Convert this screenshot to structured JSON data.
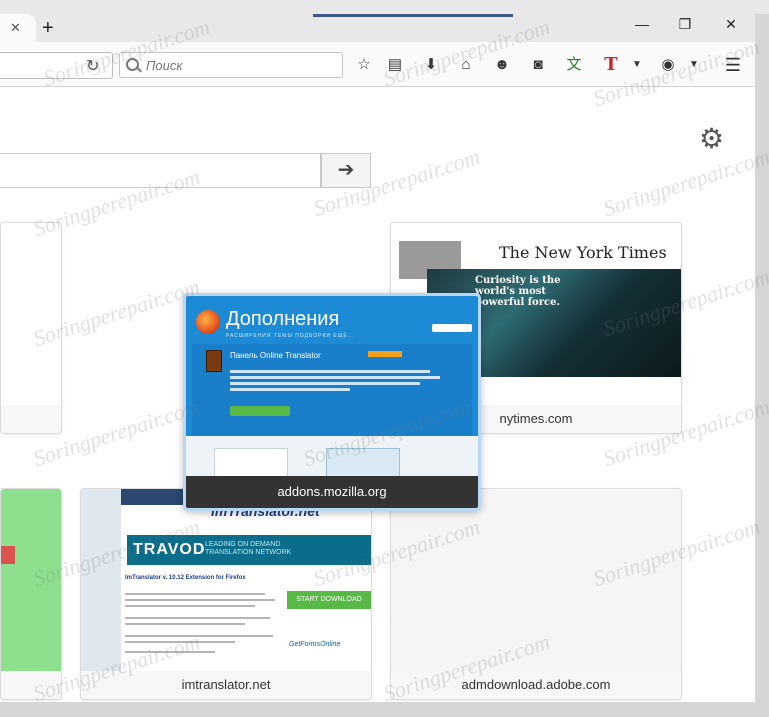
{
  "browser": {
    "search": {
      "placeholder": "Поиск"
    },
    "new_tab_symbol": "+",
    "window_controls": {
      "minimize": "—",
      "maximize": "❐",
      "close": "✕"
    }
  },
  "new_tab_page": {
    "search_go_symbol": "➔",
    "tiles": [
      {
        "id": "left1",
        "label": ""
      },
      {
        "id": "nyt",
        "label": "nytimes.com",
        "thumb": {
          "masthead": "The New York Times",
          "headline": "Curiosity is the world's most powerful force."
        }
      },
      {
        "id": "amo",
        "label": "addons.mozilla.org",
        "thumb": {
          "title": "Дополнения",
          "nav": "РАСШИРЕНИЯ ТЕМЫ ПОДБОРКИ ЕЩЁ...",
          "addon": "Панель Online Translator"
        }
      },
      {
        "id": "left2",
        "label": ""
      },
      {
        "id": "imt",
        "label": "imtranslator.net",
        "thumb": {
          "logo": "imTranslator.net",
          "banner": "TRAVOD",
          "banner_sub": "LEADING ON DEMAND TRANSLATION NETWORK",
          "subtitle": "ImTranslator v. 10.12 Extension for Firefox",
          "download": "START DOWNLOAD",
          "getforms": "GetFormsOnline"
        }
      },
      {
        "id": "adm",
        "label": "admdownload.adobe.com"
      }
    ]
  },
  "watermark": "Soringperepair.com",
  "colors": {
    "chrome": "#e8e8e8",
    "toolbar": "#fafafa",
    "amo_blue": "#1d8ad6",
    "highlight": "#b9d6f2"
  }
}
